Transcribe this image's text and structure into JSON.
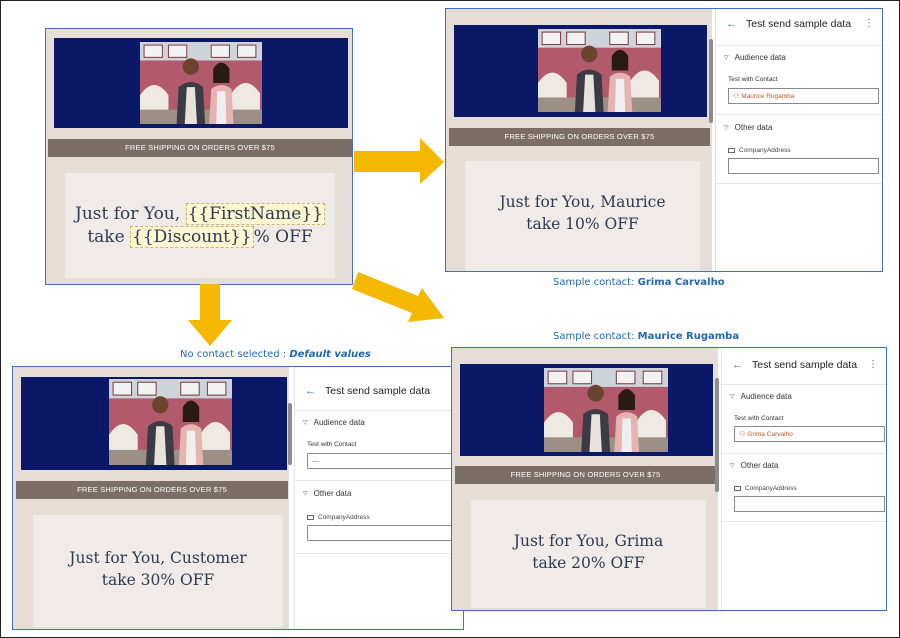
{
  "colors": {
    "frame_border": "#3f6fc6",
    "email_header_bg": "#0b1767",
    "shipping_band_bg": "#7b6e66",
    "email_bg": "#e6ddd7",
    "arrow_fill": "#f5b800",
    "caption_text": "#1f66b3",
    "accent_blue": "#2b6cd1",
    "contact_text": "#c05a2a"
  },
  "template": {
    "shipping_banner": "FREE SHIPPING ON ORDERS OVER $75",
    "greeting_prefix": "Just for You, ",
    "firstname_token": "{{FirstName}}",
    "take_prefix": "take ",
    "discount_token": "{{Discount}}",
    "discount_suffix": "% OFF"
  },
  "preview_maurice": {
    "shipping_banner": "FREE SHIPPING ON ORDERS OVER $75",
    "line1": "Just for You, Maurice",
    "line2": "take 10% OFF",
    "pane": {
      "title": "Test send sample data",
      "section_audience": "Audience data",
      "contact_label": "Test with Contact",
      "contact_value": "Maurice Rugamba",
      "section_other": "Other data",
      "address_label": "CompanyAddress"
    }
  },
  "preview_default": {
    "shipping_banner": "FREE SHIPPING ON ORDERS OVER $75",
    "line1": "Just for You, Customer",
    "line2": "take 30% OFF",
    "pane": {
      "title": "Test send sample data",
      "section_audience": "Audience data",
      "contact_label": "Test with Contact",
      "contact_value": "---",
      "section_other": "Other data",
      "address_label": "CompanyAddress"
    }
  },
  "preview_grima": {
    "shipping_banner": "FREE SHIPPING ON ORDERS OVER $75",
    "line1": "Just for You, Grima",
    "line2": "take 20% OFF",
    "pane": {
      "title": "Test send sample data",
      "section_audience": "Audience data",
      "contact_label": "Test with Contact",
      "contact_value": "Grima Carvalho",
      "section_other": "Other data",
      "address_label": "CompanyAddress"
    }
  },
  "captions": {
    "grima_prefix": "Sample contact: ",
    "grima_name": "Grima Carvalho",
    "default_prefix": "No contact selected : ",
    "default_value": "Default values",
    "maurice_prefix": "Sample contact: ",
    "maurice_name": "Maurice Rugamba"
  },
  "icons": {
    "back": "arrow-left-icon",
    "more": "more-vertical-icon",
    "section_toggle": "chevron-down-icon",
    "contact": "person-icon",
    "address": "document-icon",
    "flow": "arrow-icon"
  }
}
